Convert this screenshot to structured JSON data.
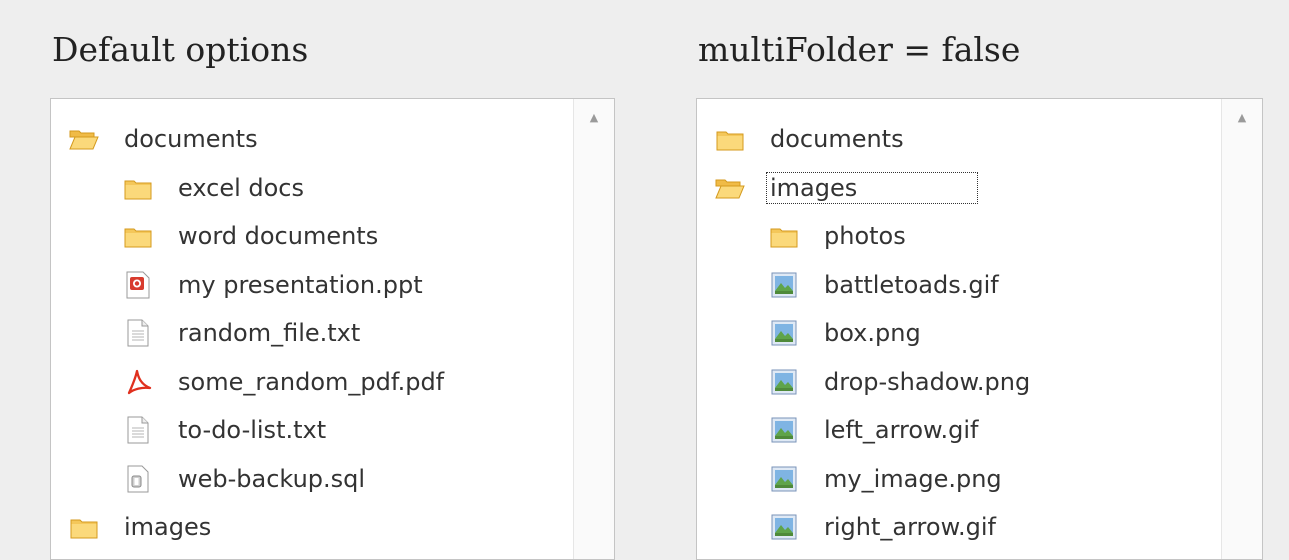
{
  "left": {
    "title": "Default options",
    "items": [
      {
        "label": "documents",
        "icon": "folder-open-icon",
        "depth": 0
      },
      {
        "label": "excel docs",
        "icon": "folder-icon",
        "depth": 1
      },
      {
        "label": "word documents",
        "icon": "folder-icon",
        "depth": 1
      },
      {
        "label": "my presentation.ppt",
        "icon": "ppt-file-icon",
        "depth": 1
      },
      {
        "label": "random_file.txt",
        "icon": "text-file-icon",
        "depth": 1
      },
      {
        "label": "some_random_pdf.pdf",
        "icon": "pdf-file-icon",
        "depth": 1
      },
      {
        "label": "to-do-list.txt",
        "icon": "text-file-icon",
        "depth": 1
      },
      {
        "label": "web-backup.sql",
        "icon": "sql-file-icon",
        "depth": 1
      },
      {
        "label": "images",
        "icon": "folder-icon",
        "depth": 0
      }
    ]
  },
  "right": {
    "title": "multiFolder = false",
    "items": [
      {
        "label": "documents",
        "icon": "folder-icon",
        "depth": 0
      },
      {
        "label": "images",
        "icon": "folder-open-icon",
        "depth": 0,
        "focused": true
      },
      {
        "label": "photos",
        "icon": "folder-icon",
        "depth": 1
      },
      {
        "label": "battletoads.gif",
        "icon": "image-file-icon",
        "depth": 1
      },
      {
        "label": "box.png",
        "icon": "image-file-icon",
        "depth": 1
      },
      {
        "label": "drop-shadow.png",
        "icon": "image-file-icon",
        "depth": 1
      },
      {
        "label": "left_arrow.gif",
        "icon": "image-file-icon",
        "depth": 1
      },
      {
        "label": "my_image.png",
        "icon": "image-file-icon",
        "depth": 1
      },
      {
        "label": "right_arrow.gif",
        "icon": "image-file-icon",
        "depth": 1
      }
    ]
  },
  "scroll_up_glyph": "▲"
}
